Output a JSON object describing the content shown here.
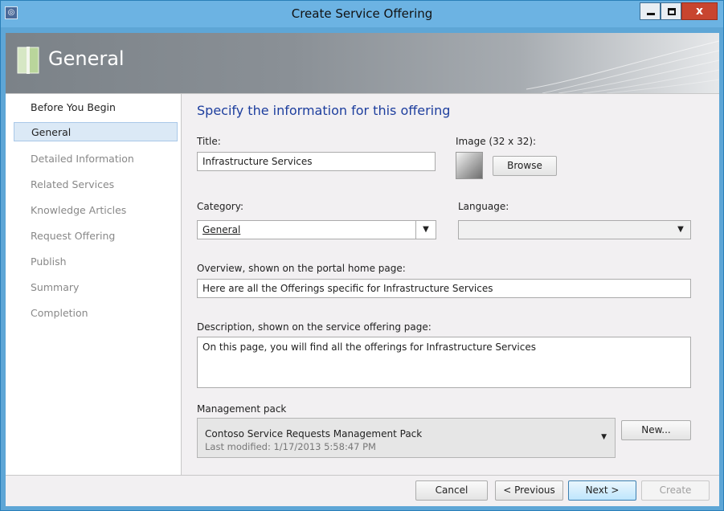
{
  "window": {
    "title": "Create Service Offering",
    "minimize_icon": "minimize-icon",
    "maximize_icon": "maximize-icon",
    "close_icon": "close-icon",
    "close_label": "x",
    "accent_color": "#6cb3e3"
  },
  "header": {
    "title": "General",
    "icon": "book-icon"
  },
  "nav": {
    "items": [
      {
        "label": "Before You Begin",
        "state": "done"
      },
      {
        "label": "General",
        "state": "active"
      },
      {
        "label": "Detailed Information",
        "state": "pending"
      },
      {
        "label": "Related Services",
        "state": "pending"
      },
      {
        "label": "Knowledge Articles",
        "state": "pending"
      },
      {
        "label": "Request Offering",
        "state": "pending"
      },
      {
        "label": "Publish",
        "state": "pending"
      },
      {
        "label": "Summary",
        "state": "pending"
      },
      {
        "label": "Completion",
        "state": "pending"
      }
    ]
  },
  "form": {
    "heading": "Specify the information for this offering",
    "title_label": "Title:",
    "title_value": "Infrastructure Services",
    "image_label": "Image (32 x 32):",
    "browse_label": "Browse",
    "category_label": "Category:",
    "category_value": "General",
    "language_label": "Language:",
    "language_value": "",
    "overview_label": "Overview, shown on the portal home page:",
    "overview_value": "Here are all the Offerings specific for Infrastructure Services",
    "description_label": "Description, shown on the service offering page:",
    "description_value": "On this page, you will find all the offerings for Infrastructure Services",
    "mp_label": "Management pack",
    "mp_name": "Contoso Service Requests Management Pack",
    "mp_modified": "Last modified:  1/17/2013 5:58:47 PM",
    "mp_new_label": "New..."
  },
  "footer": {
    "cancel_label": "Cancel",
    "previous_label": "< Previous",
    "next_label": "Next >",
    "create_label": "Create"
  }
}
